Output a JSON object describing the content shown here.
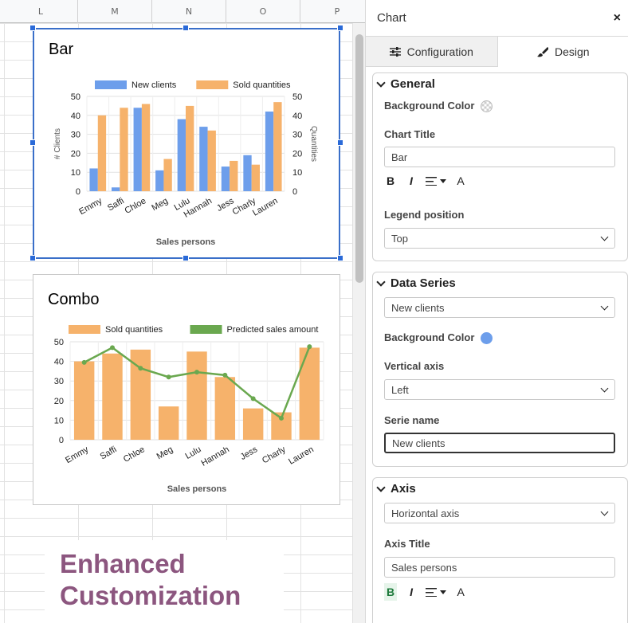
{
  "sheet": {
    "columns": [
      "L",
      "M",
      "N",
      "O",
      "P"
    ]
  },
  "charts": [
    {
      "title": "Bar",
      "chart_data": {
        "type": "bar",
        "title": "Bar",
        "categories": [
          "Emmy",
          "Saffi",
          "Chloe",
          "Meg",
          "Lulu",
          "Hannah",
          "Jess",
          "Charly",
          "Lauren"
        ],
        "series": [
          {
            "name": "New clients",
            "values": [
              12,
              2,
              44,
              11,
              38,
              34,
              13,
              19,
              42
            ],
            "color": "#6d9eeb"
          },
          {
            "name": "Sold quantities",
            "values": [
              40,
              44,
              46,
              17,
              45,
              32,
              16,
              14,
              47
            ],
            "color": "#f6b26b"
          }
        ],
        "xlabel": "Sales persons",
        "ylabel": "# Clients",
        "y2label": "Quantities",
        "ylim": [
          0,
          50
        ],
        "yticks": [
          "0",
          "10",
          "20",
          "30",
          "40",
          "50"
        ],
        "legend": "top",
        "grid": true
      }
    },
    {
      "title": "Combo",
      "chart_data": {
        "type": "bar",
        "title": "Combo",
        "categories": [
          "Emmy",
          "Saffi",
          "Chloe",
          "Meg",
          "Lulu",
          "Hannah",
          "Jess",
          "Charly",
          "Lauren"
        ],
        "series": [
          {
            "name": "Sold quantities",
            "type": "bar",
            "values": [
              40,
              44,
              46,
              17,
              45,
              32,
              16,
              14,
              47
            ],
            "color": "#f6b26b"
          },
          {
            "name": "Predicted sales amount",
            "type": "line",
            "values": [
              39.5,
              47,
              36.5,
              32,
              34.5,
              33,
              21,
              11,
              47.5
            ],
            "color": "#6aa84f"
          }
        ],
        "xlabel": "Sales persons",
        "ylim": [
          0,
          50
        ],
        "yticks": [
          "0",
          "10",
          "20",
          "30",
          "40",
          "50"
        ],
        "legend": "top",
        "grid": true
      }
    }
  ],
  "promo": {
    "line1": "Enhanced",
    "line2": "Customization"
  },
  "panel": {
    "title": "Chart",
    "close_label": "×",
    "tabs": [
      {
        "label": "Configuration",
        "icon": "sliders-icon"
      },
      {
        "label": "Design",
        "icon": "brush-icon"
      }
    ],
    "general": {
      "heading": "General",
      "bg_color_label": "Background Color",
      "chart_title_label": "Chart Title",
      "chart_title_value": "Bar",
      "legend_label": "Legend position",
      "legend_value": "Top"
    },
    "data_series": {
      "heading": "Data Series",
      "series_select": "New clients",
      "bg_color_label": "Background Color",
      "bg_color": "#6d9eeb",
      "vaxis_label": "Vertical axis",
      "vaxis_value": "Left",
      "serie_name_label": "Serie name",
      "serie_name_value": "New clients"
    },
    "axis": {
      "heading": "Axis",
      "axis_select": "Horizontal axis",
      "axis_title_label": "Axis Title",
      "axis_title_value": "Sales persons"
    },
    "format": {
      "bold": "B",
      "italic": "I",
      "color": "A"
    }
  }
}
